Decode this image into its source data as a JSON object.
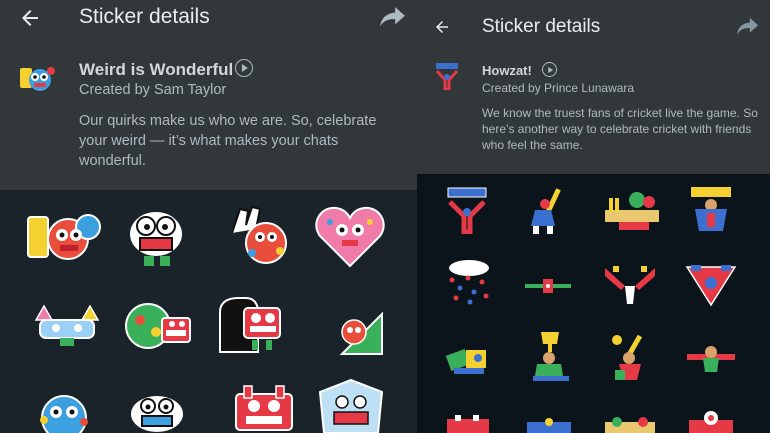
{
  "left": {
    "title": "Sticker details",
    "pack_name": "Weird is Wonderful",
    "creator": "Created by Sam Taylor",
    "description": "Our quirks make us who we are. So, celebrate your weird — it’s what makes your chats wonderful.",
    "icons": {
      "back": "arrow-left-icon",
      "share": "share-arrow-icon",
      "play": "play-circle-icon"
    }
  },
  "right": {
    "title": "Sticker details",
    "pack_name": "Howzat!",
    "creator": "Created by Prince Lunawara",
    "description": "We know the truest fans of cricket live the game. So here’s another way to celebrate cricket with friends who feel the same.",
    "icons": {
      "back": "arrow-left-icon",
      "share": "share-arrow-icon",
      "play": "play-circle-icon"
    }
  },
  "colors": {
    "header_bg": "#323739",
    "grid_bg_left": "#1a2329",
    "grid_bg_right": "#0b141a",
    "title_text": "#e9edef",
    "secondary_text": "#aebac1"
  }
}
